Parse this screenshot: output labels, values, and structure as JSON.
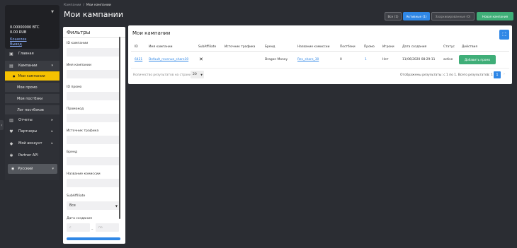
{
  "wallet": {
    "btc": "0.00000000 BTC",
    "rub": "0.00 RUB",
    "link1": "Кошелек",
    "link2": "Вывод"
  },
  "sidebar": {
    "items": [
      {
        "label": "Главная",
        "icon": "home-icon"
      },
      {
        "label": "Кампании",
        "icon": "folder-icon"
      },
      {
        "label": "Отчеты",
        "icon": "chart-icon"
      },
      {
        "label": "Партнеры",
        "icon": "partners-icon"
      },
      {
        "label": "Мой аккаунт",
        "icon": "user-icon"
      },
      {
        "label": "Partner API",
        "icon": "gear-icon"
      }
    ],
    "subitems": [
      {
        "label": "Мои кампании"
      },
      {
        "label": "Мои промо"
      },
      {
        "label": "Мои постбэки"
      },
      {
        "label": "Лог постбэков"
      }
    ],
    "language": "Русский"
  },
  "header": {
    "breadcrumb_parent": "Кампании",
    "breadcrumb_current": "Мои кампании",
    "title": "Мои кампании",
    "btn_all": "Все (1)",
    "btn_active": "Активные (1)",
    "btn_archived": "Заархивированные (0)",
    "btn_new": "Новая кампания"
  },
  "filters": {
    "title": "Фильтры",
    "campaign_id": "ID кампании",
    "campaign_name": "Имя кампании",
    "promo_id": "ID промо",
    "promo_code": "Промокод",
    "traffic_source": "Источник трафика",
    "brand": "Бренд",
    "commission_name": "Название комиссии",
    "subaffiliate": "SubAffiliate",
    "subaffiliate_value": "Все",
    "created_date": "Дата создания",
    "date_from_placeholder": "с",
    "date_to_placeholder": "по"
  },
  "table": {
    "title": "Мои кампании",
    "columns": [
      "ID",
      "Имя кампании",
      "SubAffiliate",
      "Источник трафика",
      "Бренд",
      "Название комиссии",
      "Постбэки",
      "Промо",
      "Игроки",
      "Дата создания",
      "Статус",
      "Действия"
    ],
    "row": {
      "id": "6421",
      "name": "Default_revenue_share30",
      "subaffiliate": "✕",
      "traffic_source": "",
      "brand": "Dragon Money",
      "commission": "Rev_share_30",
      "postbacks": "0",
      "promo": "1",
      "players": "Нет",
      "created": "11/06/2020 08:29:11",
      "status": "active",
      "action": "Добавить промо"
    },
    "rpp_label": "Количество результатов на странице:",
    "rpp_value": "20",
    "shown": "Отображены результаты: с 1 по 1. Всего результатов: 1",
    "page": "1",
    "prev": "‹",
    "next": "›"
  }
}
